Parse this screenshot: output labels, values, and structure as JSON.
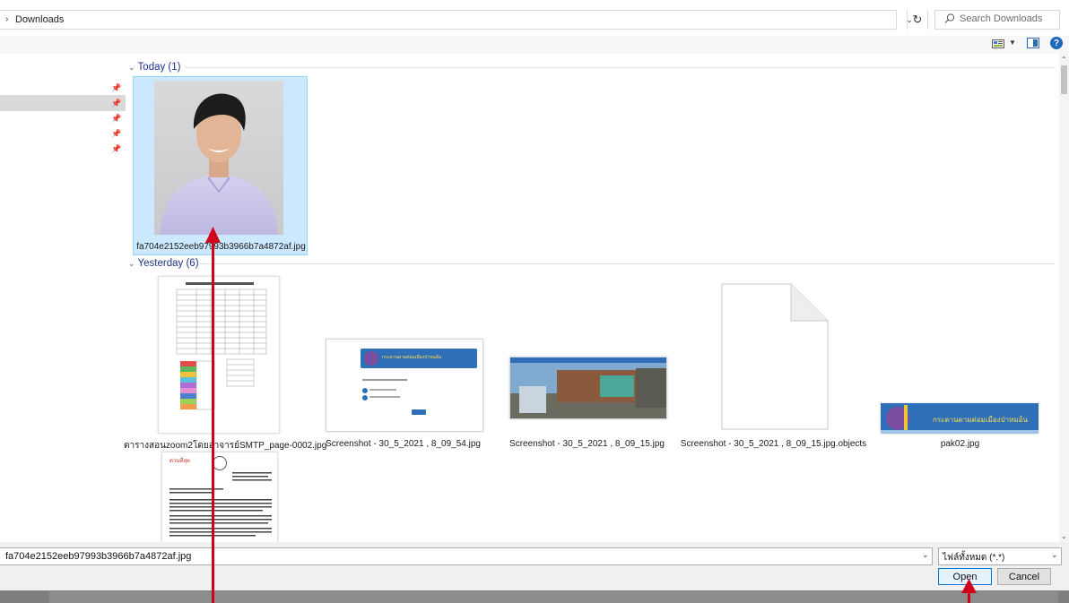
{
  "address_bar": {
    "path_chevron": "›",
    "path": "Downloads",
    "search_placeholder": "Search Downloads"
  },
  "toolbar": {
    "help_label": "?"
  },
  "groups": {
    "today": {
      "label": "Today (1)"
    },
    "yesterday": {
      "label": "Yesterday (6)"
    }
  },
  "files": {
    "f1": {
      "name": "fa704e2152eeb97993b3966b7a4872af.jpg"
    },
    "f2": {
      "name": "ตารางสอนzoom2โดยอาจารย์SMTP_page-0002.jpg"
    },
    "f3": {
      "name": "Screenshot - 30_5_2021 , 8_09_54.jpg"
    },
    "f4": {
      "name": "Screenshot - 30_5_2021 , 8_09_15.jpg"
    },
    "f5": {
      "name": "Screenshot - 30_5_2021 , 8_09_15.jpg.objects"
    },
    "f6": {
      "name": "pak02.jpg"
    }
  },
  "thumb_text": {
    "banner": "กระดานตามต่อมเมืองป่าหมอ้น",
    "doc2_head": "ด่วนที่สุด"
  },
  "bottom": {
    "filename_value": "fa704e2152eeb97993b3966b7a4872af.jpg",
    "filter_value": "ไฟล์ทั้งหมด (*.*)",
    "open_label": "Open",
    "cancel_label": "Cancel"
  },
  "colors": {
    "group_header": "#1e3287",
    "selection": "#cce8ff",
    "annotation_arrow": "#d0021b",
    "banner_bg": "#2f6fb8"
  }
}
